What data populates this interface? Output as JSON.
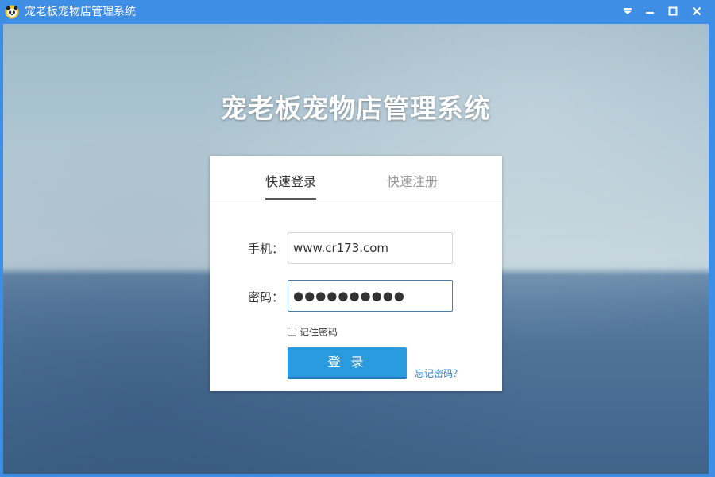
{
  "window": {
    "title": "宠老板宠物店管理系统",
    "controls": {
      "menu_icon": "chevron-down-icon",
      "minimize_icon": "minimize-icon",
      "maximize_icon": "maximize-icon",
      "close_icon": "close-icon"
    }
  },
  "hero": {
    "title": "宠老板宠物店管理系统"
  },
  "tabs": [
    {
      "label": "快速登录",
      "active": true
    },
    {
      "label": "快速注册",
      "active": false
    }
  ],
  "form": {
    "phone_label": "手机：",
    "phone_value": "www.cr173.com",
    "password_label": "密码：",
    "password_value": "●●●●●●●●●●",
    "remember_label": "记住密码",
    "remember_checked": false,
    "login_button": "登 录",
    "forgot_link": "忘记密码？"
  },
  "colors": {
    "titlebar": "#3e8ee6",
    "login_button": "#2a9bde",
    "link": "#2b7bc4",
    "input_focus_border": "#4a7eaf"
  }
}
